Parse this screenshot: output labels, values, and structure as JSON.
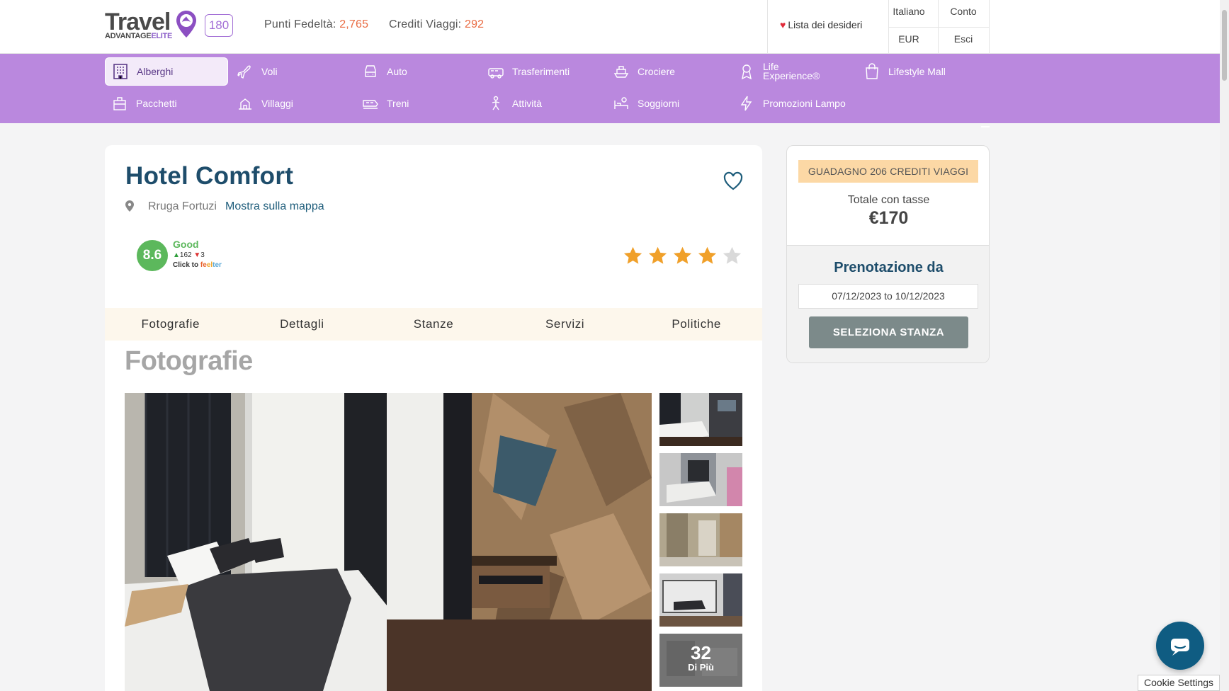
{
  "header": {
    "logo_top": "Travel",
    "logo_bottom_a": "ADVANTAGE",
    "logo_bottom_b": "ELITE",
    "badge": "180",
    "points_label": "Punti Fedeltà:",
    "points_value": "2,765",
    "credits_label": "Crediti Viaggi:",
    "credits_value": "292",
    "wishlist": "Lista dei desideri",
    "language": "Italiano",
    "account": "Conto",
    "currency": "EUR",
    "logout": "Esci"
  },
  "nav": {
    "items": [
      {
        "label": "Alberghi",
        "icon": "hotel-icon"
      },
      {
        "label": "Voli",
        "icon": "plane-icon"
      },
      {
        "label": "Auto",
        "icon": "car-icon"
      },
      {
        "label": "Trasferimenti",
        "icon": "transfer-icon"
      },
      {
        "label": "Crociere",
        "icon": "cruise-icon"
      },
      {
        "label": "Life Experience®",
        "icon": "experience-icon"
      },
      {
        "label": "Lifestyle Mall",
        "icon": "shopping-bag-icon"
      },
      {
        "label": "Pacchetti",
        "icon": "package-icon"
      },
      {
        "label": "Villaggi",
        "icon": "resort-icon"
      },
      {
        "label": "Treni",
        "icon": "train-icon"
      },
      {
        "label": "Attività",
        "icon": "activity-icon"
      },
      {
        "label": "Soggiorni",
        "icon": "stay-icon"
      },
      {
        "label": "Promozioni Lampo",
        "icon": "lightning-icon"
      }
    ]
  },
  "hotel": {
    "name": "Hotel Comfort",
    "address": "Rruga Fortuzi",
    "map_link": "Mostra sulla mappa",
    "score": "8.6",
    "score_label": "Good",
    "votes_up": "162",
    "votes_down": "3",
    "click_to": "Click to",
    "feelter_a": "fe",
    "feelter_b": "el",
    "feelter_c": "ter",
    "stars": 4,
    "max_stars": 5
  },
  "tabs": [
    "Fotografie",
    "Dettagli",
    "Stanze",
    "Servizi",
    "Politiche"
  ],
  "photos": {
    "section_title": "Fotografie",
    "more_count": "32",
    "more_label": "Di Più"
  },
  "booking": {
    "earn": "GUADAGNO 206 CREDITI VIAGGI",
    "total_label": "Totale con tasse",
    "total_value": "€170",
    "book_label": "Prenotazione da",
    "dates": "07/12/2023 to 10/12/2023",
    "select_button": "SELEZIONA STANZA"
  },
  "cookie": "Cookie Settings",
  "colors": {
    "accent_orange": "#e96b42",
    "nav_purple": "#ba88de",
    "title_blue": "#1e4d6b",
    "score_green": "#5cb85c",
    "star_gold": "#f0a02a",
    "button_grey": "#7c8a8a",
    "chat_blue": "#0f5c82"
  }
}
